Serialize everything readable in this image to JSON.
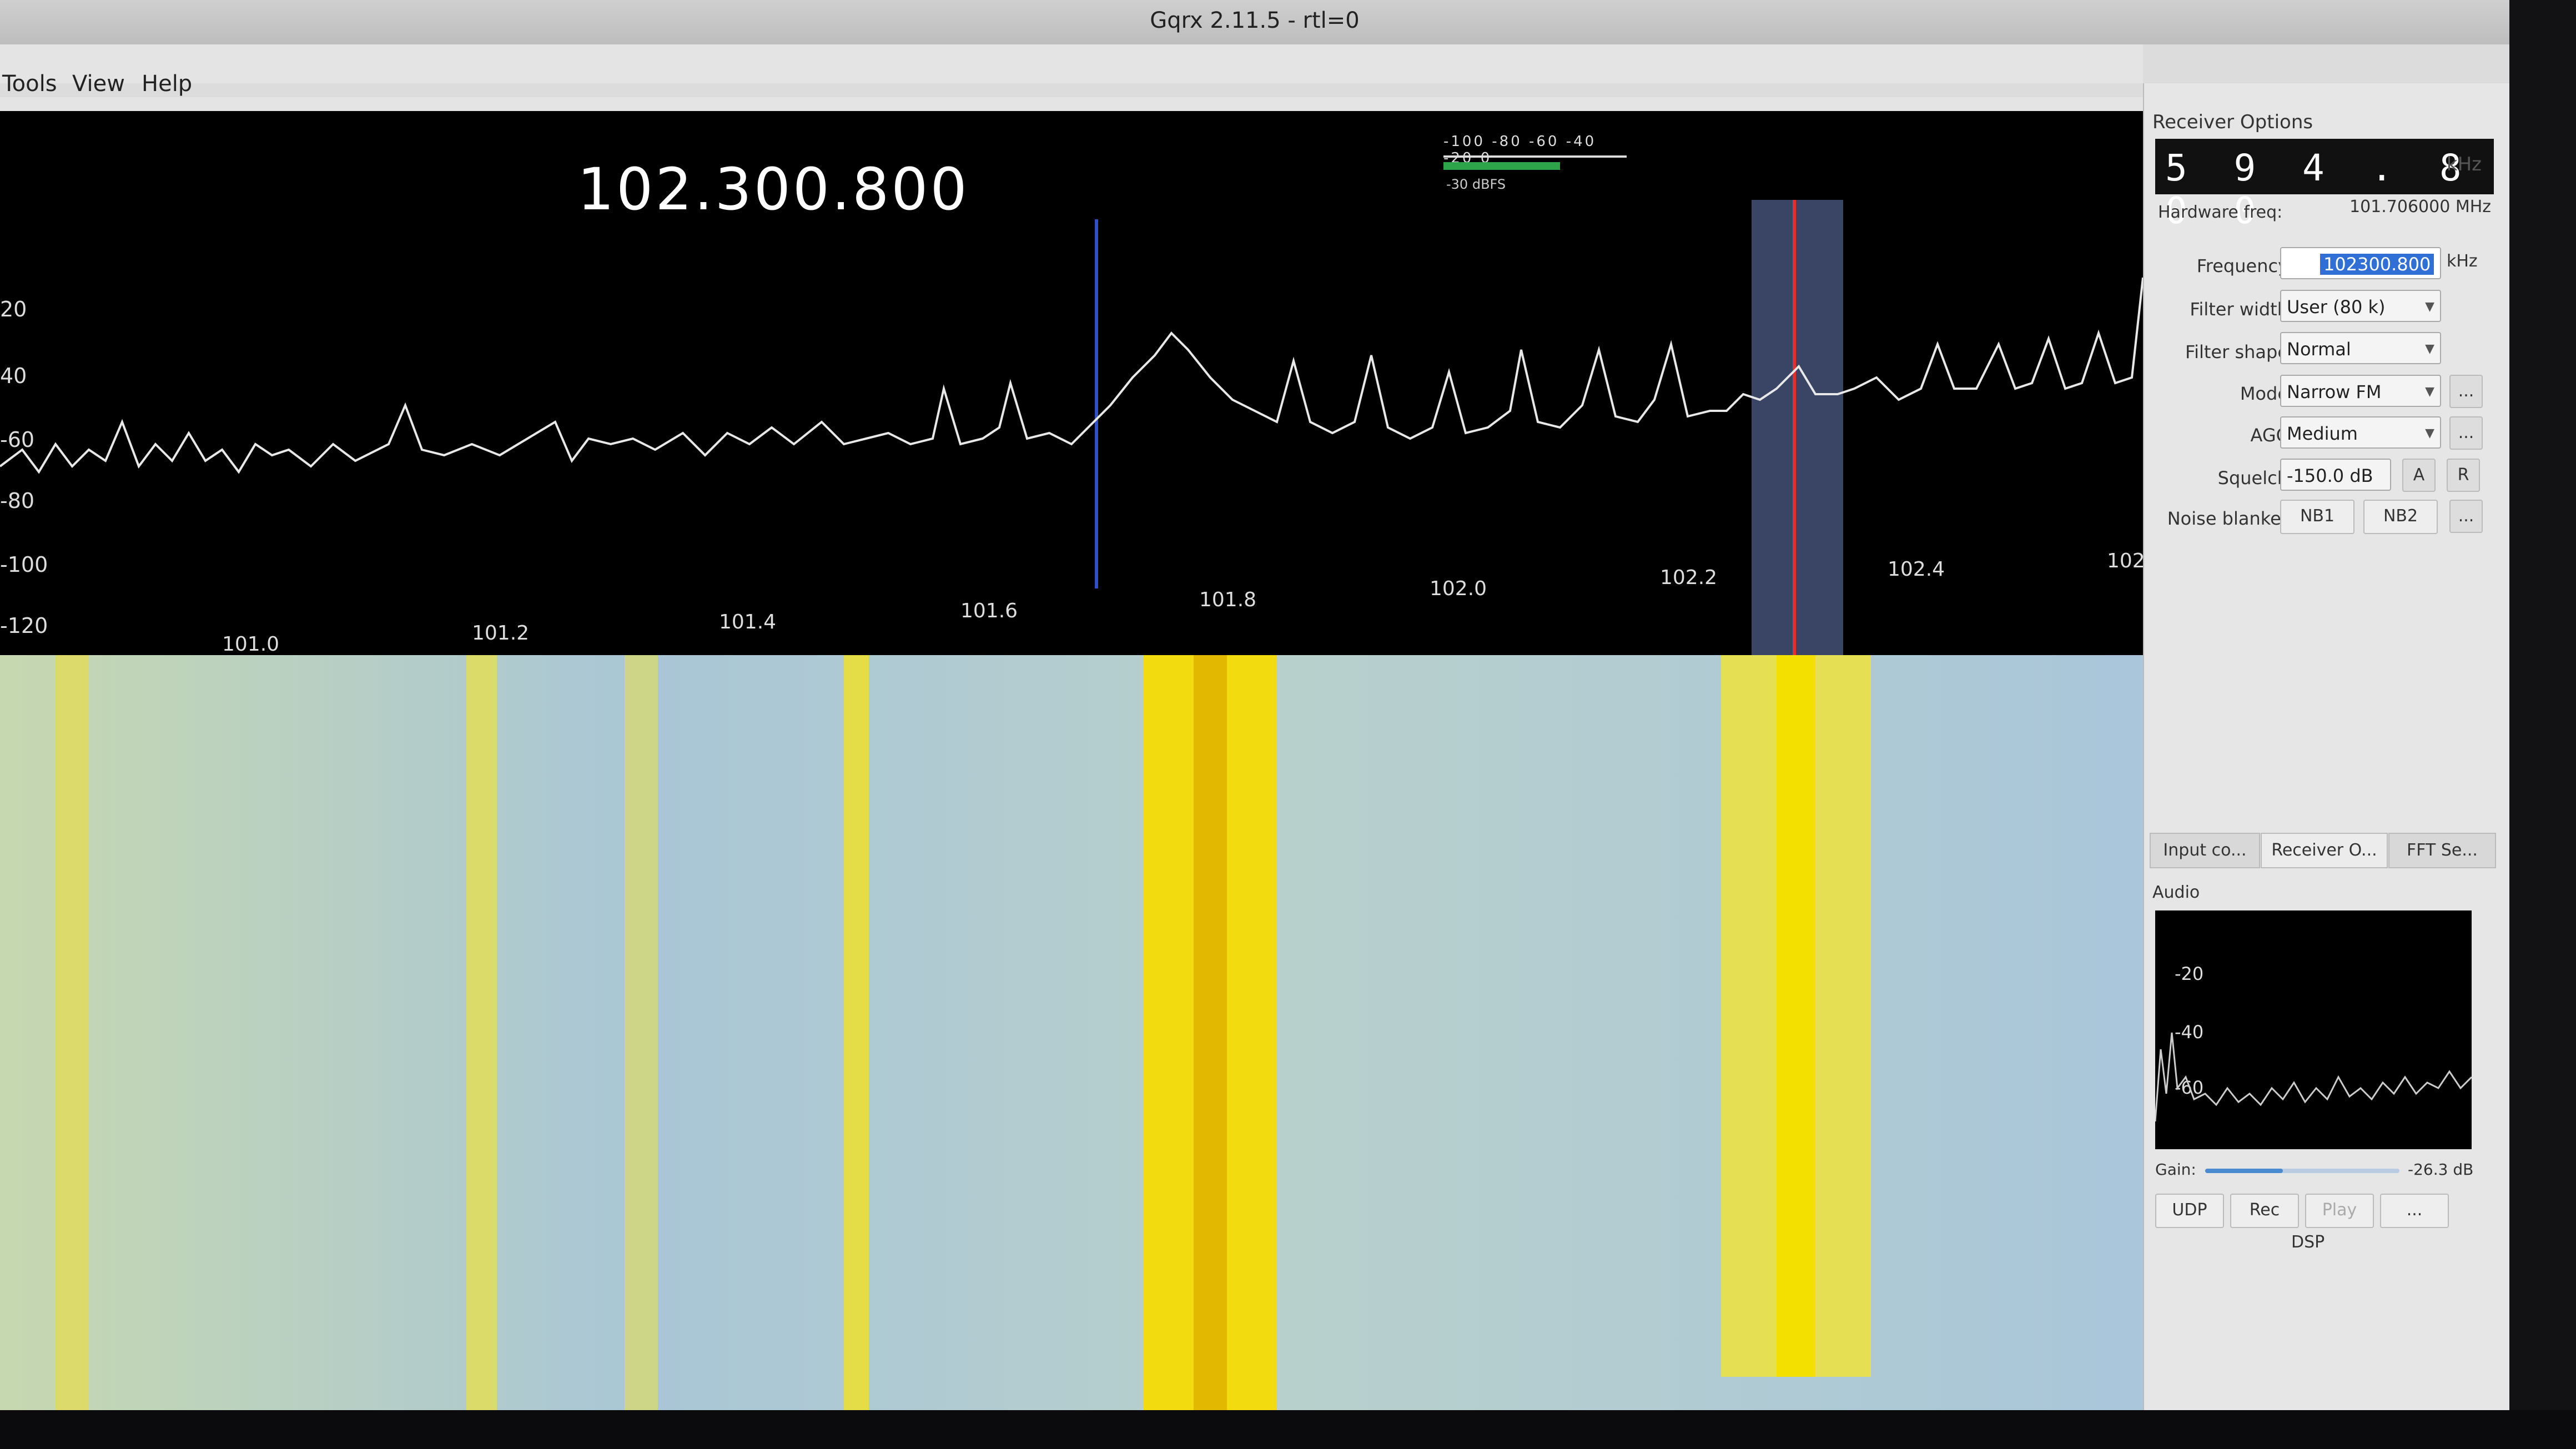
{
  "window": {
    "title": "Gqrx 2.11.5 - rtl=0"
  },
  "menubar": {
    "items": [
      "Tools",
      "View",
      "Help"
    ]
  },
  "toolbar": {
    "icons": [
      "device-icon",
      "open-icon",
      "save-icon",
      "import-icon",
      "screen-icon",
      "stack-icon",
      "cut-icon",
      "move-icon"
    ]
  },
  "spectrum": {
    "center_frequency": "102.300.800",
    "smeter": {
      "scale": "-100 -80 -60 -40 -20 0",
      "reference": "-30 dBFS"
    },
    "y_labels": [
      "20",
      "40",
      "-60",
      "-80",
      "-100",
      "-120"
    ],
    "x_labels": [
      "101.0",
      "101.2",
      "101.4",
      "101.6",
      "101.8",
      "102.0",
      "102.2",
      "102.4",
      "102"
    ]
  },
  "receiver_options": {
    "title": "Receiver Options",
    "lcd_value": "5 9 4 . 8 0 0",
    "lcd_unit": "kHz",
    "hardware_freq_label": "Hardware freq:",
    "hardware_freq_value": "101.706000 MHz",
    "frequency_label": "Frequency",
    "frequency_value": "102300.800",
    "frequency_unit": "kHz",
    "filter_width_label": "Filter width",
    "filter_width_value": "User (80 k)",
    "filter_shape_label": "Filter shape",
    "filter_shape_value": "Normal",
    "mode_label": "Mode",
    "mode_value": "Narrow FM",
    "agc_label": "AGC",
    "agc_value": "Medium",
    "squelch_label": "Squelch",
    "squelch_value": "-150.0 dB",
    "squelch_a": "A",
    "squelch_r": "R",
    "noise_blanker_label": "Noise blanker",
    "nb1": "NB1",
    "nb2": "NB2",
    "more": "..."
  },
  "tabs": [
    "Input co...",
    "Receiver O...",
    "FFT Se..."
  ],
  "audio": {
    "title": "Audio",
    "y_labels": [
      "-20",
      "-40",
      "-60"
    ],
    "gain_label": "Gain:",
    "gain_value": "-26.3 dB",
    "udp": "UDP",
    "rec": "Rec",
    "play": "Play",
    "more": "...",
    "dsp": "DSP"
  }
}
